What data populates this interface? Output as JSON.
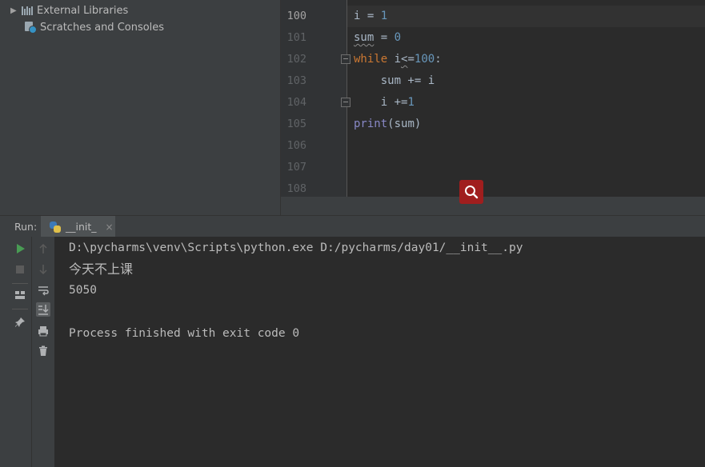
{
  "project_tree": {
    "items": [
      {
        "label": "External Libraries",
        "icon": "library-icon"
      },
      {
        "label": "Scratches and Consoles",
        "icon": "scratches-icon"
      }
    ]
  },
  "editor": {
    "lines": [
      {
        "number": "100",
        "code": "i = 1"
      },
      {
        "number": "101",
        "code": "sum = 0"
      },
      {
        "number": "102",
        "code": "while i<=100:"
      },
      {
        "number": "103",
        "code": "    sum += i"
      },
      {
        "number": "104",
        "code": "    i +=1"
      },
      {
        "number": "105",
        "code": "print(sum)"
      },
      {
        "number": "106",
        "code": ""
      },
      {
        "number": "107",
        "code": ""
      },
      {
        "number": "108",
        "code": ""
      }
    ]
  },
  "run": {
    "label": "Run:",
    "tab_label": "__init_",
    "tab_close": "×",
    "console": [
      "D:\\pycharms\\venv\\Scripts\\python.exe D:/pycharms/day01/__init__.py",
      "今天不上课",
      "5050",
      "",
      "Process finished with exit code 0"
    ]
  },
  "colors": {
    "keyword": "#cc7832",
    "number": "#6897bb",
    "builtin": "#8888c6",
    "run_green": "#499c54",
    "search_badge": "#a01e1e"
  }
}
